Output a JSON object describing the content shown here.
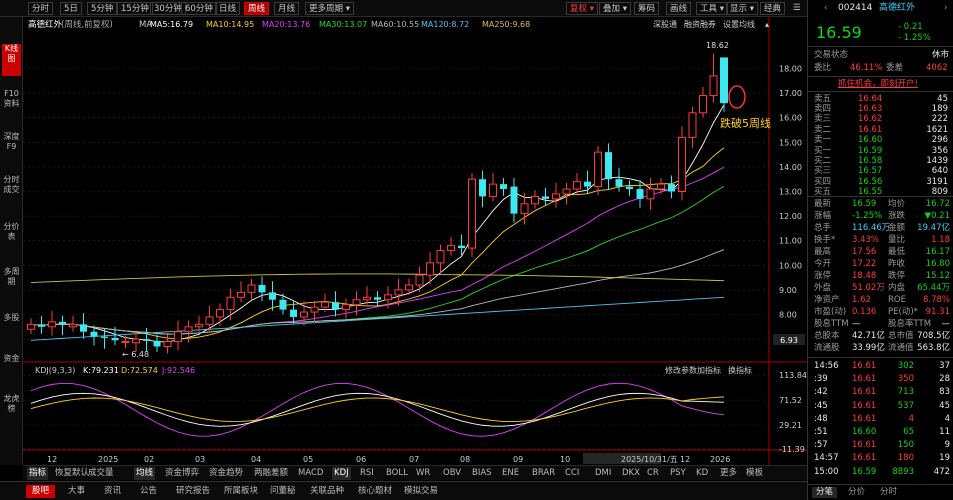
{
  "toolbar": {
    "left_items": [
      "分时",
      "5日",
      "5分钟",
      "15分钟",
      "30分钟",
      "60分钟",
      "日线",
      "周线",
      "月线",
      "更多周期"
    ],
    "active": "周线",
    "right_items": [
      "复权",
      "叠加",
      "筹码",
      "画线",
      "工具",
      "显示",
      "经典"
    ],
    "restore_label": "复权",
    "menu_icon": "settings-icon"
  },
  "left_nav": {
    "items": [
      "K线图",
      "F10资料",
      "深度F9",
      "分时成交",
      "分价表",
      "多周期",
      "多股",
      "资金",
      "龙虎榜"
    ],
    "active": "K线图"
  },
  "chart_header": {
    "title": "高德红外",
    "mode": "(周线,前复权)",
    "ma_label": "MA",
    "ma": [
      {
        "label": "MA5:16.79",
        "color": "#ffffff"
      },
      {
        "label": "MA10:14.95",
        "color": "#ffd21f"
      },
      {
        "label": "MA20:13.76",
        "color": "#e040fb"
      },
      {
        "label": "MA30:13.07",
        "color": "#22dd22"
      },
      {
        "label": "MA60:10.55",
        "color": "#b8b8b8"
      },
      {
        "label": "MA120:8.72",
        "color": "#4fc3f7"
      },
      {
        "label": "MA250:9.68",
        "color": "#d6c04a"
      }
    ],
    "links": [
      "深股通",
      "融资融券",
      "设置均线"
    ]
  },
  "price_axis": [
    "18.00",
    "17.00",
    "16.00",
    "15.00",
    "14.00",
    "13.00",
    "12.00",
    "11.00",
    "10.00",
    "9.00",
    "8.00",
    "7.00"
  ],
  "last_price_label": "6.93",
  "annotations": {
    "high": "18.62",
    "low": "6.48",
    "note": "跌破5周线"
  },
  "kdj": {
    "label": "KDJ(9,3,3)",
    "k": "K:79.231",
    "d": "D:72.574",
    "j": "J:92.546",
    "links": [
      "修改参数",
      "加指标",
      "换指标"
    ],
    "axis": [
      "113.84",
      "71.52",
      "29.21",
      "-11.39"
    ]
  },
  "time_axis": [
    "12",
    "2025",
    "02",
    "03",
    "04",
    "05",
    "06",
    "07",
    "08",
    "09",
    "10",
    "2025/10/31/五",
    "12",
    "2026"
  ],
  "bottom_tabs": [
    "指标",
    "恢复默认",
    "成交量",
    "均线",
    "资金博弈",
    "资金趋势",
    "两融差额",
    "MACD",
    "KDJ",
    "RSI",
    "BOLL",
    "WR",
    "OBV",
    "BIAS",
    "ENE",
    "BRAR",
    "CCI",
    "DMI",
    "DKX",
    "CR",
    "PSY",
    "KD",
    "更多",
    "模板"
  ],
  "bottom_active": [
    "指标",
    "均线",
    "KDJ"
  ],
  "footer_tabs": [
    "股吧",
    "大事",
    "资讯",
    "公告",
    "研究报告",
    "所属板块",
    "问董秘",
    "关联品种",
    "核心题材",
    "模拟交易"
  ],
  "footer_active": "股吧",
  "right": {
    "code": "002414",
    "name": "高德红外",
    "price": "16.59",
    "change": "- 0.21",
    "pct": "- 1.25%",
    "status_label": "交易状态",
    "status": "休市",
    "weibi_label": "委比",
    "weibi": "46.11%",
    "weicha_label": "委差",
    "weicha": "4062",
    "promo": "抓住机会，即刻开户!",
    "asks": [
      {
        "l": "卖五",
        "p": "16.64",
        "v": "45"
      },
      {
        "l": "卖四",
        "p": "16.63",
        "v": "189"
      },
      {
        "l": "卖三",
        "p": "16.62",
        "v": "222"
      },
      {
        "l": "卖二",
        "p": "16.61",
        "v": "1621"
      },
      {
        "l": "卖一",
        "p": "16.60",
        "v": "296"
      }
    ],
    "bids": [
      {
        "l": "买一",
        "p": "16.59",
        "v": "356"
      },
      {
        "l": "买二",
        "p": "16.58",
        "v": "1439"
      },
      {
        "l": "买三",
        "p": "16.57",
        "v": "640"
      },
      {
        "l": "买四",
        "p": "16.56",
        "v": "3191"
      },
      {
        "l": "买五",
        "p": "16.55",
        "v": "809"
      }
    ],
    "stats": [
      [
        "最新",
        "16.59",
        "均价",
        "16.72"
      ],
      [
        "涨幅",
        "-1.25%",
        "涨跌",
        "▼0.21"
      ],
      [
        "总手",
        "116.46万",
        "金额",
        "19.47亿"
      ],
      [
        "换手*",
        "3.43%",
        "量比",
        "1.18"
      ],
      [
        "最高",
        "17.56",
        "最低",
        "16.17"
      ],
      [
        "今开",
        "17.22",
        "昨收",
        "16.80"
      ],
      [
        "涨停",
        "18.48",
        "跌停",
        "15.12"
      ],
      [
        "外盘",
        "51.02万",
        "内盘",
        "65.44万"
      ],
      [
        "净资产",
        "1.62",
        "ROE",
        "8.78%"
      ],
      [
        "市盈(动)",
        "0.136",
        "PE(动)*",
        "91.31"
      ],
      [
        "股息TTM",
        "—",
        "股息率TTM",
        "—"
      ],
      [
        "总股本",
        "42.71亿",
        "总市值",
        "708.5亿"
      ],
      [
        "流通股",
        "33.99亿",
        "流通值",
        "563.8亿"
      ]
    ],
    "ticks": [
      {
        "t": "14:56",
        "p": "16.61",
        "v": "302",
        "n": "37"
      },
      {
        "t": ":39",
        "p": "16.61",
        "v": "350",
        "n": "28"
      },
      {
        "t": ":42",
        "p": "16.61",
        "v": "713",
        "n": "83"
      },
      {
        "t": ":45",
        "p": "16.61",
        "v": "537",
        "n": "45"
      },
      {
        "t": ":48",
        "p": "16.61",
        "v": "4",
        "n": "4"
      },
      {
        "t": ":51",
        "p": "16.60",
        "v": "65",
        "n": "11"
      },
      {
        "t": ":57",
        "p": "16.61",
        "v": "150",
        "n": "9"
      },
      {
        "t": "14:57",
        "p": "16.61",
        "v": "180",
        "n": "19"
      },
      {
        "t": "15:00",
        "p": "16.59",
        "v": "8893",
        "n": "472"
      }
    ],
    "tabs": [
      "分笔",
      "分价",
      "分时"
    ]
  }
}
